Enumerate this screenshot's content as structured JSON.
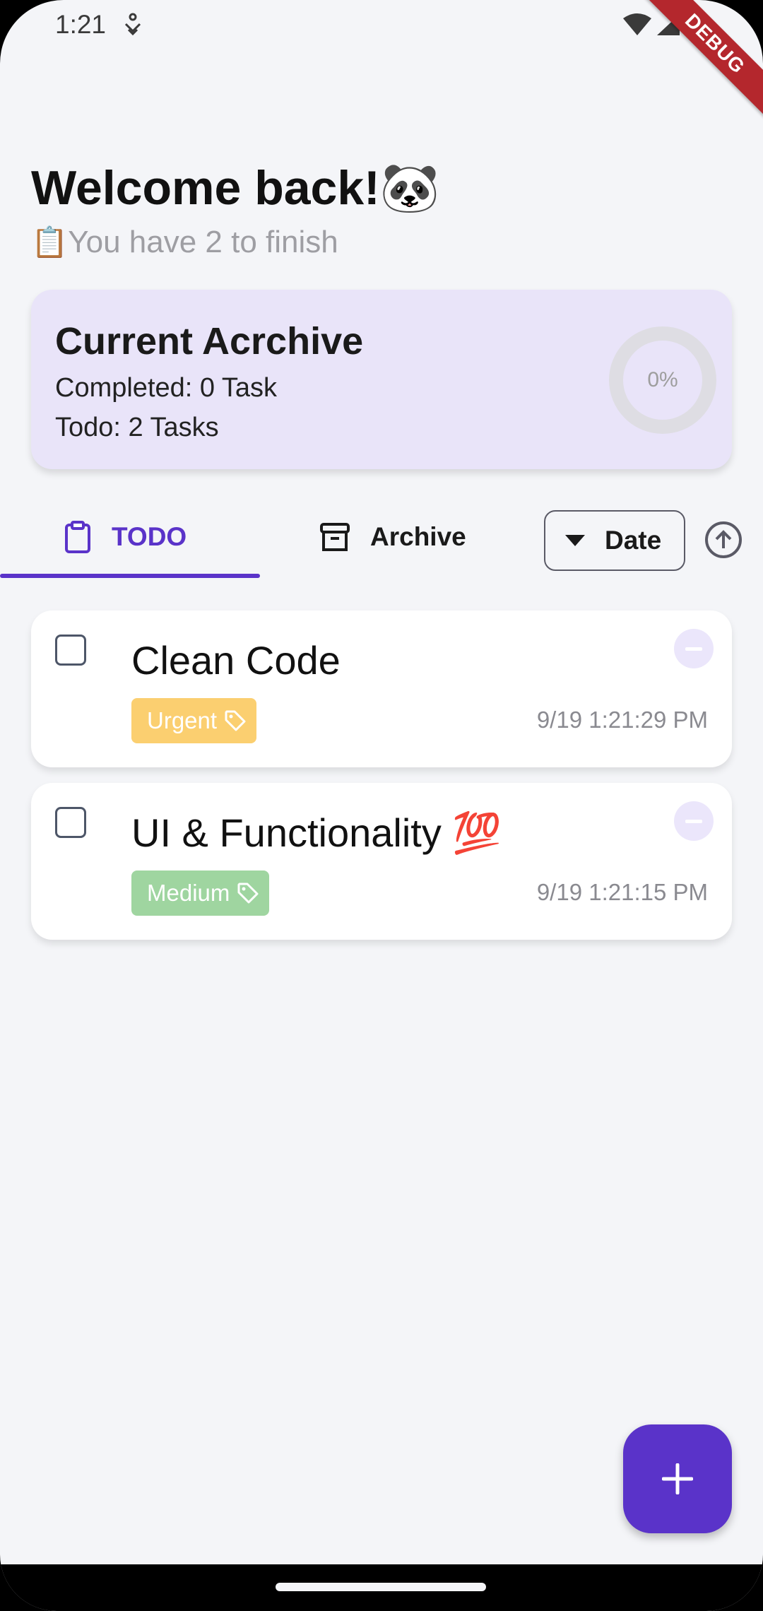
{
  "status_bar": {
    "time": "1:21",
    "icons": [
      "person-sync-icon",
      "wifi-icon",
      "cell-signal-icon"
    ],
    "debug_banner": "DEBUG"
  },
  "header": {
    "welcome": "Welcome back!🐼",
    "subtitle_emoji": "📋",
    "subtitle": "You have 2 to finish"
  },
  "summary": {
    "title": "Current Acrchive",
    "completed": "Completed: 0 Task",
    "todo": "Todo: 2 Tasks",
    "progress_label": "0%",
    "progress_value": 0
  },
  "tabs": [
    {
      "label": "TODO",
      "icon": "clipboard-icon",
      "selected": true
    },
    {
      "label": "Archive",
      "icon": "archive-box-icon",
      "selected": false
    }
  ],
  "sort": {
    "label": "Date",
    "icon": "dropdown-triangle-icon",
    "direction_icon": "arrow-up-circle-icon"
  },
  "tasks": [
    {
      "title": "Clean Code",
      "tag": "Urgent",
      "tag_color": "#fbcf70",
      "date": "9/19 1:21:29 PM"
    },
    {
      "title": "UI & Functionality 💯",
      "tag": "Medium",
      "tag_color": "#9fd5a0",
      "date": "9/19 1:21:15 PM"
    }
  ],
  "colors": {
    "accent": "#5a33c9",
    "background": "#f4f5f8",
    "summary_card": "#e9e4f9",
    "remove_button": "#ebe6fb"
  },
  "fab": {
    "icon": "plus-icon"
  }
}
